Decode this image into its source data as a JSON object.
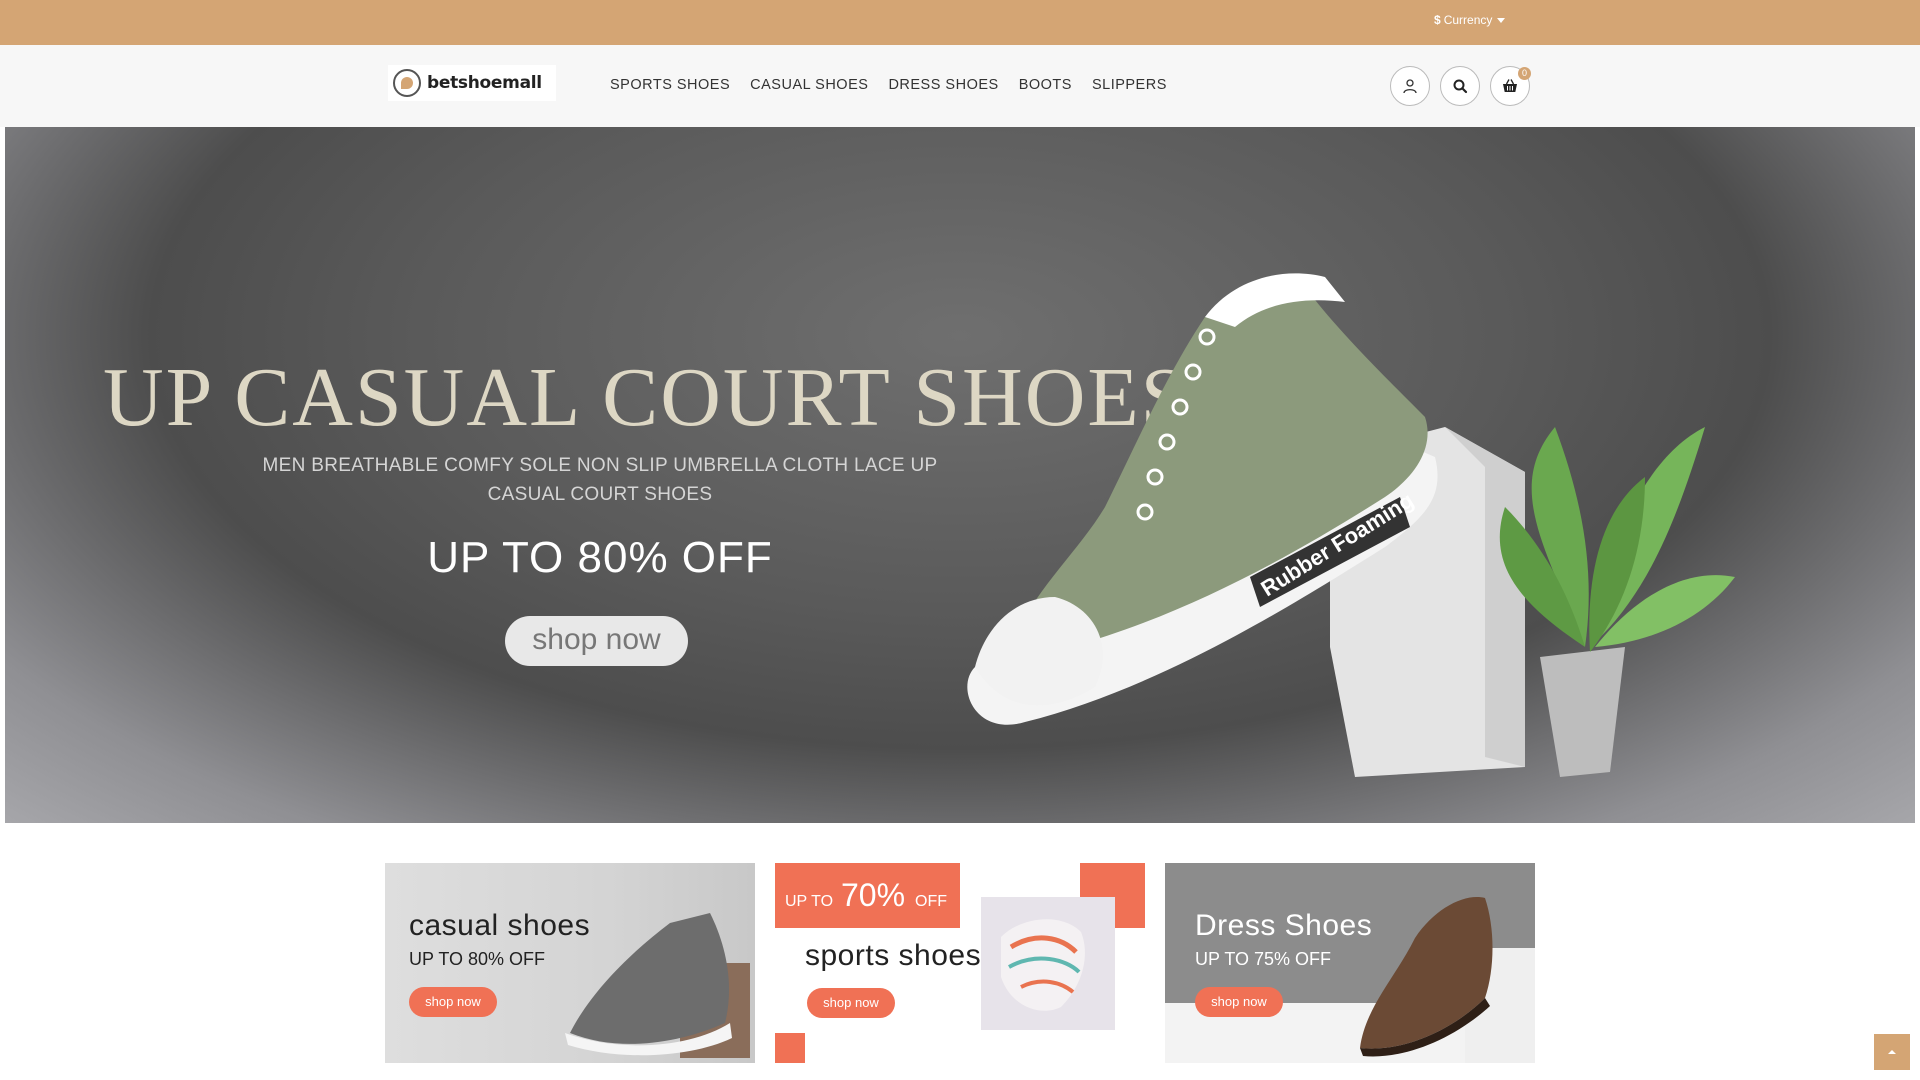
{
  "topbar": {
    "currency_symbol": "$",
    "currency_label": "Currency"
  },
  "header": {
    "logo_text": "betshoemall",
    "nav": [
      "SPORTS SHOES",
      "CASUAL SHOES",
      "DRESS SHOES",
      "BOOTS",
      "SLIPPERS"
    ],
    "cart_count": "0",
    "icons": [
      "user-icon",
      "search-icon",
      "basket-icon"
    ]
  },
  "hero": {
    "title": "UP CASUAL COURT SHOES",
    "subtitle": "MEN BREATHABLE COMFY SOLE NON SLIP UMBRELLA CLOTH LACE UP CASUAL COURT SHOES",
    "offer": "UP TO 80% OFF",
    "button": "shop now",
    "shoe_print": "Rubber Foaming"
  },
  "promos": {
    "casual": {
      "title": "casual shoes",
      "offer": "UP TO 80% OFF",
      "button": "shop now"
    },
    "sports": {
      "badge_prefix": "UP TO",
      "badge_pct": "70%",
      "badge_suffix": "OFF",
      "title": "sports shoes",
      "button": "shop now"
    },
    "dress": {
      "title": "Dress Shoes",
      "offer": "UP TO 75% OFF",
      "button": "shop now"
    }
  },
  "colors": {
    "topbar": "#d4a574",
    "accent": "#f07155"
  }
}
